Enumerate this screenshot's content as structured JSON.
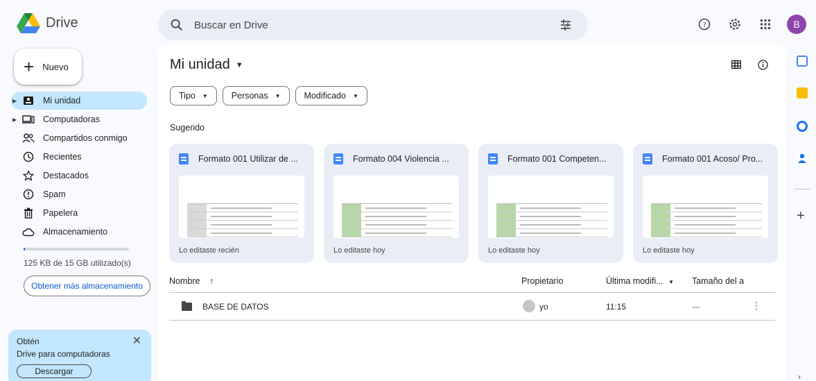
{
  "app": {
    "name": "Drive"
  },
  "search": {
    "placeholder": "Buscar en Drive"
  },
  "account": {
    "initial": "B"
  },
  "sidebar": {
    "new_label": "Nuevo",
    "items": [
      {
        "label": "Mi unidad",
        "icon": "drive-icon",
        "active": true,
        "caret": true
      },
      {
        "label": "Computadoras",
        "icon": "computer-icon",
        "active": false,
        "caret": true
      },
      {
        "label": "Compartidos conmigo",
        "icon": "people-icon",
        "active": false,
        "caret": false
      },
      {
        "label": "Recientes",
        "icon": "clock-icon",
        "active": false,
        "caret": false
      },
      {
        "label": "Destacados",
        "icon": "star-icon",
        "active": false,
        "caret": false
      },
      {
        "label": "Spam",
        "icon": "spam-icon",
        "active": false,
        "caret": false
      },
      {
        "label": "Papelera",
        "icon": "trash-icon",
        "active": false,
        "caret": false
      },
      {
        "label": "Almacenamiento",
        "icon": "cloud-icon",
        "active": false,
        "caret": false
      }
    ],
    "storage_text": "125 KB de 15 GB utilizado(s)",
    "storage_fraction": 0.01,
    "more_storage_label": "Obtener más almacenamiento",
    "promo": {
      "title": "Obtén",
      "subtitle": "Drive para computadoras",
      "button": "Descargar"
    }
  },
  "main": {
    "title": "Mi unidad",
    "filters": [
      "Tipo",
      "Personas",
      "Modificado"
    ],
    "suggested_label": "Sugerido",
    "suggested": [
      {
        "title": "Formato 001 Utilizar de ...",
        "footer": "Lo editaste recién"
      },
      {
        "title": "Formato 004 Violencia ...",
        "footer": "Lo editaste hoy"
      },
      {
        "title": "Formato 001 Competen...",
        "footer": "Lo editaste hoy"
      },
      {
        "title": "Formato 001 Acoso/ Pro...",
        "footer": "Lo editaste hoy"
      }
    ],
    "columns": {
      "name": "Nombre",
      "owner": "Propietario",
      "modified": "Última modifi...",
      "size": "Tamaño del a"
    },
    "rows": [
      {
        "name": "BASE DE DATOS",
        "owner": "yo",
        "modified": "11:15",
        "size": "—"
      }
    ]
  },
  "colors": {
    "accent": "#0b57d0",
    "active_nav": "#c2e7ff",
    "doc_blue": "#4285f4",
    "thumb_green": "#b7d7a8",
    "thumb_gray": "#d9d9d9"
  }
}
